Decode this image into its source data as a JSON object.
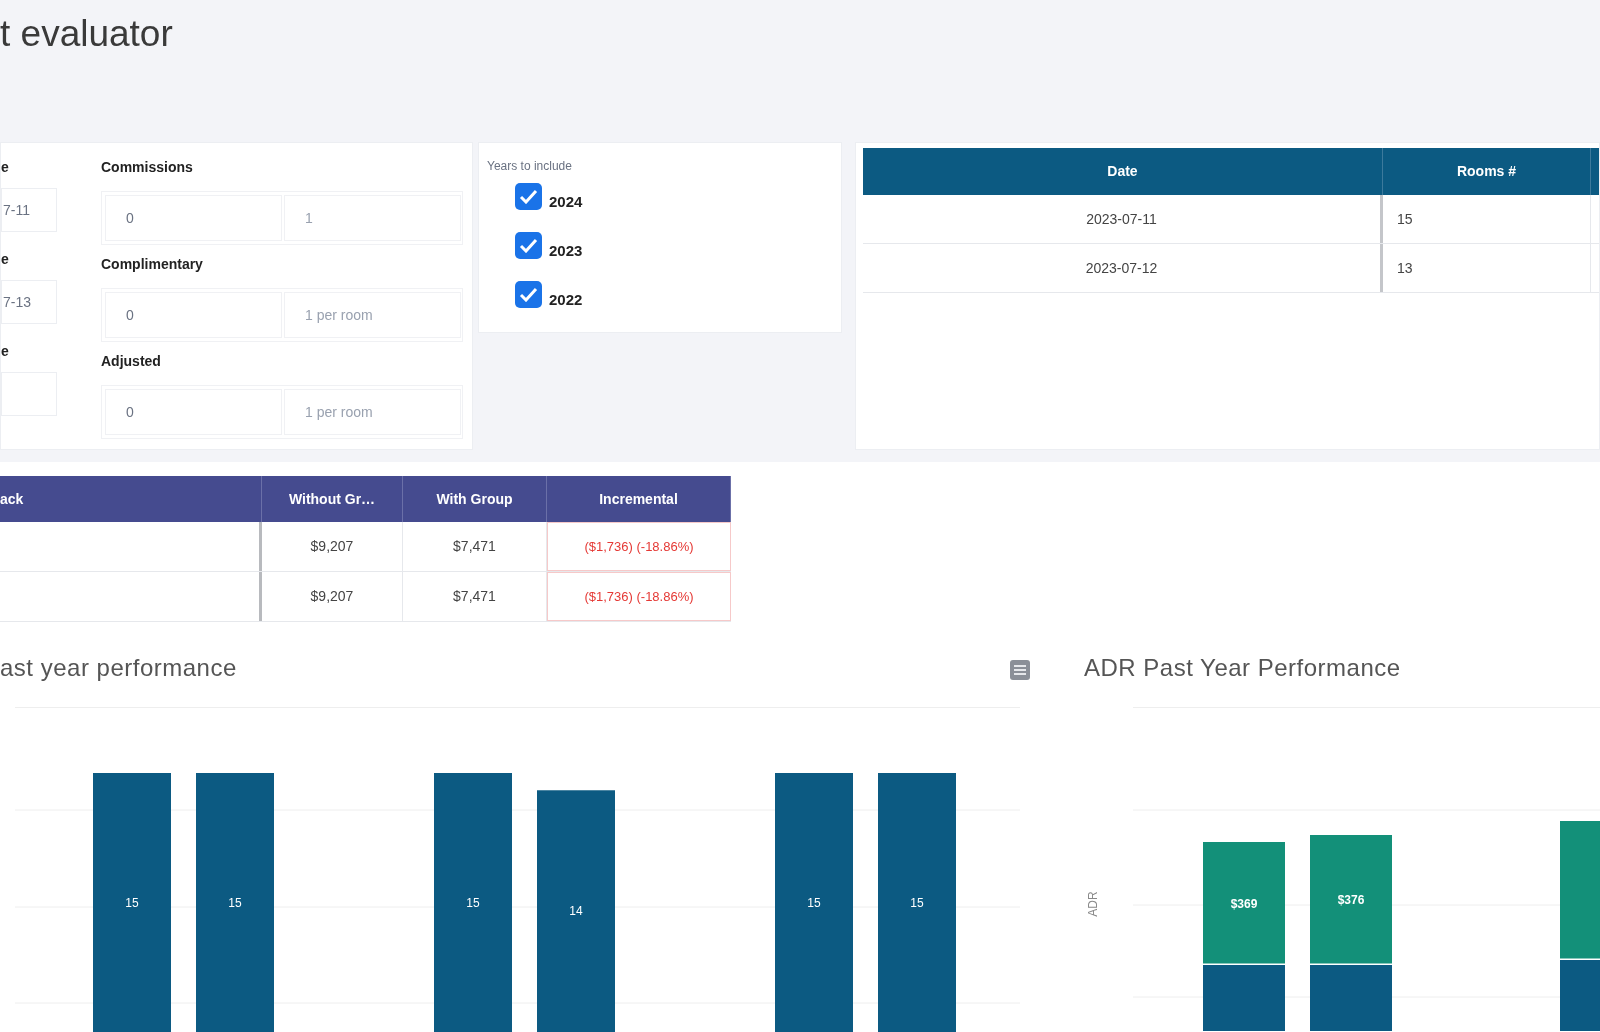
{
  "title": "t evaluator",
  "settings_panel": {
    "left_fields": [
      {
        "label": "e",
        "value": "7-11"
      },
      {
        "label": "e",
        "value": "7-13"
      },
      {
        "label": "e"
      }
    ],
    "groups": [
      {
        "label": "Commissions",
        "fields": [
          {
            "value": "0"
          },
          {
            "placeholder": "1"
          }
        ]
      },
      {
        "label": "Complimentary",
        "fields": [
          {
            "value": "0"
          },
          {
            "placeholder": "1 per room"
          }
        ]
      },
      {
        "label": "Adjusted",
        "fields": [
          {
            "value": "0"
          },
          {
            "placeholder": "1 per room"
          }
        ]
      }
    ]
  },
  "years": {
    "label": "Years to include",
    "options": [
      {
        "label": "2024",
        "checked": true
      },
      {
        "label": "2023",
        "checked": true
      },
      {
        "label": "2022",
        "checked": true
      }
    ]
  },
  "dates_table": {
    "columns": [
      "Date",
      "Rooms #"
    ],
    "rows": [
      [
        "2023-07-11",
        "15"
      ],
      [
        "2023-07-12",
        "13"
      ]
    ]
  },
  "summary_table": {
    "columns": [
      "ack",
      "Without Gr…",
      "With Group",
      "Incremental"
    ],
    "rows": [
      {
        "without_group": "$9,207",
        "with_group": "$7,471",
        "incremental": "($1,736) (-18.86%)",
        "negative": true
      },
      {
        "without_group": "$9,207",
        "with_group": "$7,471",
        "incremental": "($1,736) (-18.86%)",
        "negative": true
      }
    ]
  },
  "past_year_chart": {
    "chart_data": {
      "type": "bar",
      "title": "ast year performance",
      "data_labels": true,
      "categories": [
        null,
        null,
        null
      ],
      "series": [
        {
          "color": "#0c5a82",
          "values": [
            15,
            15,
            15
          ]
        },
        {
          "color": "#0c5a82",
          "values": [
            15,
            14,
            15
          ]
        }
      ]
    }
  },
  "adr_chart": {
    "title": "ADR Past Year Performance",
    "ylabel": "ADR",
    "bar_labels": [
      "$369",
      "$376"
    ]
  }
}
